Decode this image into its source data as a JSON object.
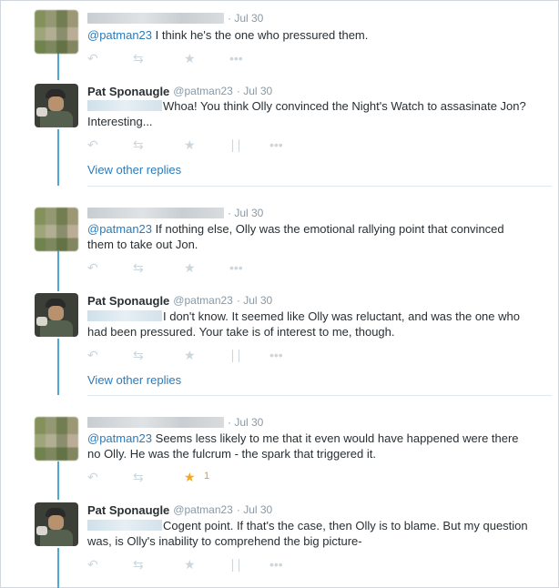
{
  "conversation": [
    {
      "kind": "reply-from-other",
      "meta": "· Jul 30",
      "mention": "@patman23",
      "text": " I think he's the one who pressured them.",
      "fav_count": ""
    },
    {
      "kind": "reply-from-pat",
      "name": "Pat Sponaugle",
      "handle": "@patman23",
      "meta": "· Jul 30",
      "text": "Whoa! You think Olly convinced the Night's Watch to assasinate Jon? Interesting...",
      "view_replies": "View other replies"
    },
    {
      "kind": "reply-from-other",
      "meta": "· Jul 30",
      "mention": "@patman23",
      "text": " If nothing else, Olly was the emotional rallying point that convinced them to take out Jon.",
      "fav_count": ""
    },
    {
      "kind": "reply-from-pat",
      "name": "Pat Sponaugle",
      "handle": "@patman23",
      "meta": "· Jul 30",
      "text": "I don't know. It seemed like Olly was reluctant, and was the one who had been pressured. Your take is of interest to me, though.",
      "view_replies": "View other replies"
    },
    {
      "kind": "reply-from-other",
      "meta": "· Jul 30",
      "mention": "@patman23",
      "text": " Seems less likely to me that it even would have happened were there no Olly. He was the fulcrum - the spark that triggered it.",
      "fav_count": "1"
    },
    {
      "kind": "reply-from-pat",
      "name": "Pat Sponaugle",
      "handle": "@patman23",
      "meta": "· Jul 30",
      "text": "Cogent point. If that's the case, then Olly is to blame. But my question was, is Olly's inability to comprehend the big picture-"
    }
  ],
  "icons": {
    "reply": "reply-icon",
    "retweet": "retweet-icon",
    "favorite": "star-icon",
    "analytics": "analytics-icon",
    "more": "more-icon"
  },
  "colors": {
    "thread_line": "#4fa7d6",
    "link": "#2b7bb9",
    "favorite_active": "#f5a623",
    "muted": "#8899a6",
    "icon": "#ccd6dd"
  }
}
